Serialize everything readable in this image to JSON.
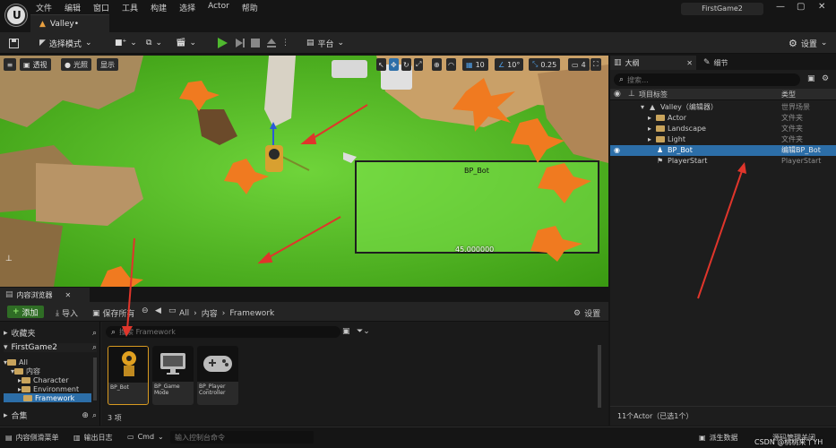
{
  "titlebar": {
    "menu": [
      "文件",
      "编辑",
      "窗口",
      "工具",
      "构建",
      "选择",
      "Actor",
      "帮助"
    ],
    "level_tab": "Valley•",
    "project": "FirstGame2"
  },
  "toolbar": {
    "mode": "选择模式",
    "platform": "平台",
    "settings": "设置"
  },
  "viewport": {
    "perspective": "透视",
    "lit": "光照",
    "show": "显示",
    "grid_snap": "10",
    "rot_snap": "10°",
    "scale_snap": "0.25",
    "camera_speed": "4",
    "actor_label": "BP_Bot",
    "measure_label": "45.000000"
  },
  "content_browser": {
    "tab": "内容浏览器",
    "add": "添加",
    "import": "导入",
    "save_all": "保存所有",
    "path": [
      "All",
      "内容",
      "Framework"
    ],
    "settings": "设置",
    "favorites": "收藏夹",
    "project": "FirstGame2",
    "tree": [
      "All",
      "内容",
      "Character",
      "Environment",
      "Framework"
    ],
    "collections": "合集",
    "search_placeholder": "搜索 Framework",
    "assets": [
      {
        "name": "BP_Bot"
      },
      {
        "name": "BP_Game Mode"
      },
      {
        "name": "BP_Player Controller"
      }
    ],
    "count": "3 项"
  },
  "outliner": {
    "tab": "大纲",
    "details_tab": "细节",
    "search_placeholder": "搜索...",
    "col_label": "项目标签",
    "col_type": "类型",
    "rows": [
      {
        "label": "Valley（编辑器）",
        "type": "世界场景"
      },
      {
        "label": "Actor",
        "type": "文件夹"
      },
      {
        "label": "Landscape",
        "type": "文件夹"
      },
      {
        "label": "Light",
        "type": "文件夹"
      },
      {
        "label": "BP_Bot",
        "type": "编辑BP_Bot"
      },
      {
        "label": "PlayerStart",
        "type": "PlayerStart"
      }
    ],
    "footer": "11个Actor（已选1个）"
  },
  "statusbar": {
    "drawer": "内容侧滑菜单",
    "output": "输出日志",
    "cmd": "Cmd",
    "console_placeholder": "输入控制台命令",
    "derived": "派生数据",
    "source": "源码管理关闭",
    "watermark": "CSDN @桃桃来丫YH"
  },
  "colors": {
    "accent": "#2c6ea8",
    "play_green": "#4fb82f",
    "add_green": "#2f6d25",
    "annotation_red": "#e0352b"
  }
}
